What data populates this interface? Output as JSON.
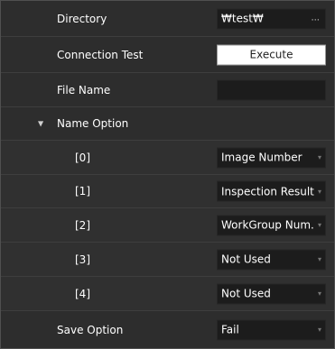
{
  "properties": {
    "directory": {
      "label": "Directory",
      "value": "₩test₩",
      "browse_label": "..."
    },
    "connection_test": {
      "label": "Connection Test",
      "button_label": "Execute"
    },
    "file_name": {
      "label": "File Name",
      "value": ""
    },
    "name_option": {
      "label": "Name Option",
      "expanded": true,
      "items": [
        {
          "label": "[0]",
          "value": "Image Number"
        },
        {
          "label": "[1]",
          "value": "Inspection Result"
        },
        {
          "label": "[2]",
          "value": "WorkGroup Num..."
        },
        {
          "label": "[3]",
          "value": "Not Used"
        },
        {
          "label": "[4]",
          "value": "Not Used"
        }
      ]
    },
    "save_option": {
      "label": "Save Option",
      "value": "Fail"
    }
  }
}
